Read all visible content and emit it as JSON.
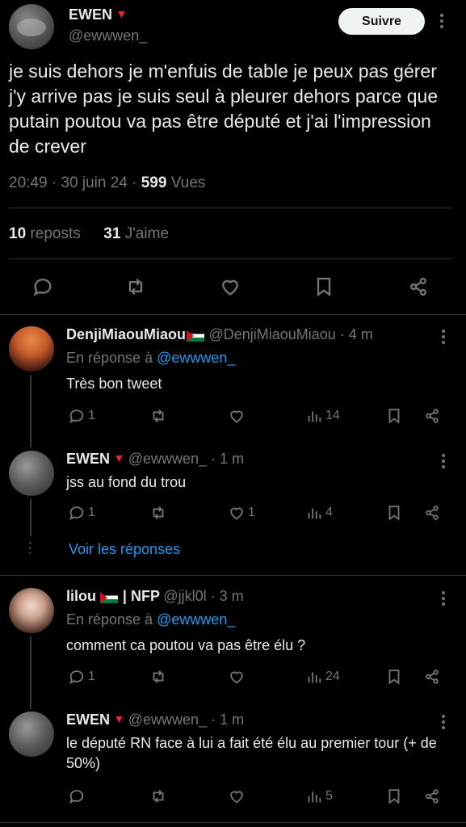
{
  "main_tweet": {
    "author_name": "EWEN",
    "author_handle": "@ewwwen_",
    "follow_label": "Suivre",
    "text": "je suis dehors je m'enfuis de table je peux pas gérer j'y arrive pas je suis seul à pleurer dehors parce que putain poutou va pas être député et j'ai l'impression de crever",
    "time": "20:49 · 30 juin 24 · ",
    "views_count": "599",
    "views_label": " Vues",
    "reposts_count": "10",
    "reposts_label": " reposts",
    "likes_count": "31",
    "likes_label": " J'aime"
  },
  "replies": [
    {
      "author_name": "DenjiMiaouMiaou",
      "handle_time": "@DenjiMiaouMiaou · 4 m",
      "in_reply_prefix": "En réponse à ",
      "in_reply_handle": "@ewwwen_",
      "text": "Très bon tweet",
      "replies": "1",
      "reposts": "",
      "likes": "",
      "views": "14"
    },
    {
      "author_name": "EWEN",
      "handle_time": "@ewwwen_ · 1 m",
      "text": "jss au fond du trou",
      "replies": "1",
      "reposts": "",
      "likes": "1",
      "views": "4"
    },
    {
      "author_name": "lilou",
      "author_suffix": "| NFP",
      "handle_time": "@jjkl0l · 3 m",
      "in_reply_prefix": "En réponse à ",
      "in_reply_handle": "@ewwwen_",
      "text": "comment ca poutou va pas être élu ?",
      "replies": "1",
      "reposts": "",
      "likes": "",
      "views": "24"
    },
    {
      "author_name": "EWEN",
      "handle_time": "@ewwwen_ · 1 m",
      "text": "le député RN face à lui a fait été élu au premier tour (+ de 50%)",
      "replies": "",
      "reposts": "",
      "likes": "",
      "views": "5"
    }
  ],
  "show_replies_label": "Voir les réponses",
  "colors": {
    "accent": "#1d9bf0",
    "muted": "#71767b",
    "text": "#e7e9ea",
    "verified_triangle": "#f4212e"
  },
  "icons": [
    "reply-icon",
    "repost-icon",
    "like-icon",
    "bookmark-icon",
    "share-icon",
    "views-icon",
    "more-icon",
    "triangle-icon",
    "palestine-flag-icon"
  ]
}
